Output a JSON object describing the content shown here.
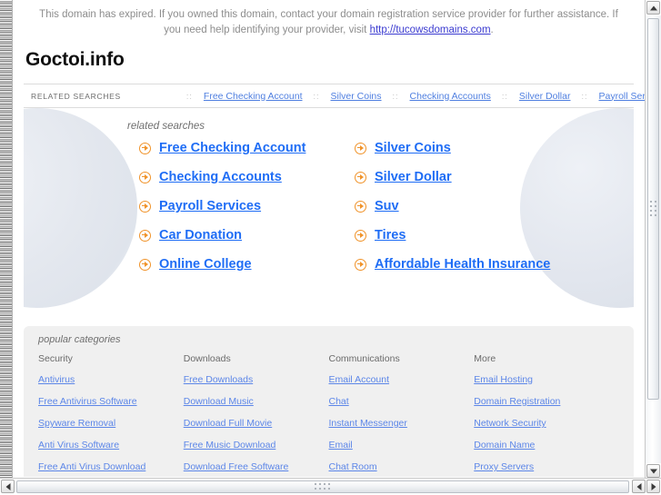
{
  "notice": {
    "text_before_link": "This domain has expired. If you owned this domain, contact your domain registration service provider for further assistance. If you need help identifying your provider, visit ",
    "link_text": "http://tucowsdomains.com",
    "text_after_link": "."
  },
  "domain_title": "Goctoi.info",
  "navbar": {
    "label": "RELATED SEARCHES",
    "separator": "::",
    "links": [
      "Free Checking Account",
      "Silver Coins",
      "Checking Accounts",
      "Silver Dollar",
      "Payroll Services"
    ]
  },
  "results": {
    "heading": "related searches",
    "items": [
      "Free Checking Account",
      "Silver Coins",
      "Checking Accounts",
      "Silver Dollar",
      "Payroll Services",
      "Suv",
      "Car Donation",
      "Tires",
      "Online College",
      "Affordable Health Insurance"
    ]
  },
  "categories": {
    "heading": "popular categories",
    "columns": [
      {
        "title": "Security",
        "links": [
          "Antivirus",
          "Free Antivirus Software",
          "Spyware Removal",
          "Anti Virus Software",
          "Free Anti Virus Download"
        ]
      },
      {
        "title": "Downloads",
        "links": [
          "Free Downloads",
          "Download Music",
          "Download Full Movie",
          "Free Music Download",
          "Download Free Software"
        ]
      },
      {
        "title": "Communications",
        "links": [
          "Email Account",
          "Chat",
          "Instant Messenger",
          "Email",
          "Chat Room"
        ]
      },
      {
        "title": "More",
        "links": [
          "Email Hosting",
          "Domain Registration",
          "Network Security",
          "Domain Name",
          "Proxy Servers"
        ]
      }
    ]
  },
  "colors": {
    "link_blue": "#1f6df5",
    "nav_link_blue": "#4f7fe0",
    "arrow_orange": "#f0932a",
    "notice_grey": "#8d8d8d",
    "category_bg": "#f0f0f0"
  }
}
